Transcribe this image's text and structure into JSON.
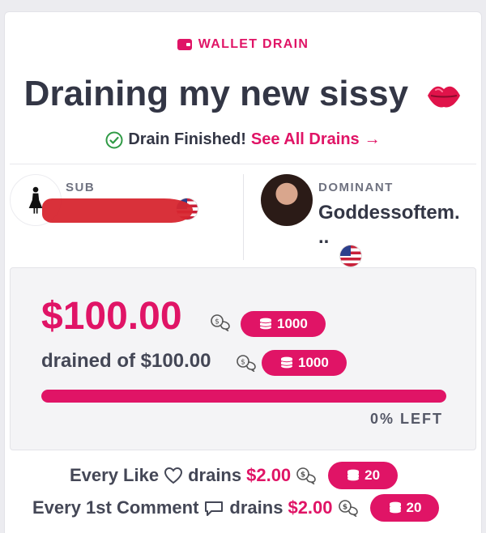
{
  "header": {
    "kicker": "WALLET DRAIN",
    "kicker_icon": "wallet-icon",
    "title": "Draining my new sissy",
    "title_emoji": "lips-emoji"
  },
  "status": {
    "text": "Drain Finished!",
    "link_label": "See All Drains",
    "link_arrow": "→",
    "icon": "check-circle-icon"
  },
  "sub": {
    "label": "SUB",
    "name": "",
    "avatar_icon": "person-silhouette-icon",
    "flag": "us-flag-icon"
  },
  "dominant": {
    "label": "DOMINANT",
    "name": "Goddessoftem.",
    "name_cont": "..",
    "flag": "us-flag-icon"
  },
  "drain": {
    "amount": "$100.00",
    "tokens": "1000",
    "drained_text": "drained of $100.00",
    "total_tokens": "1000",
    "progress_used_fraction": 1.0,
    "left_text": "0% LEFT"
  },
  "rules": [
    {
      "prefix": "Every Like",
      "icon": "heart-outline-icon",
      "verb": "drains",
      "price": "$2.00",
      "tokens": "20"
    },
    {
      "prefix": "Every 1st Comment",
      "icon": "comment-icon",
      "verb": "drains",
      "price": "$2.00",
      "tokens": "20"
    }
  ],
  "colors": {
    "accent": "#e01466",
    "text": "#333645",
    "background": "#ffffff"
  }
}
